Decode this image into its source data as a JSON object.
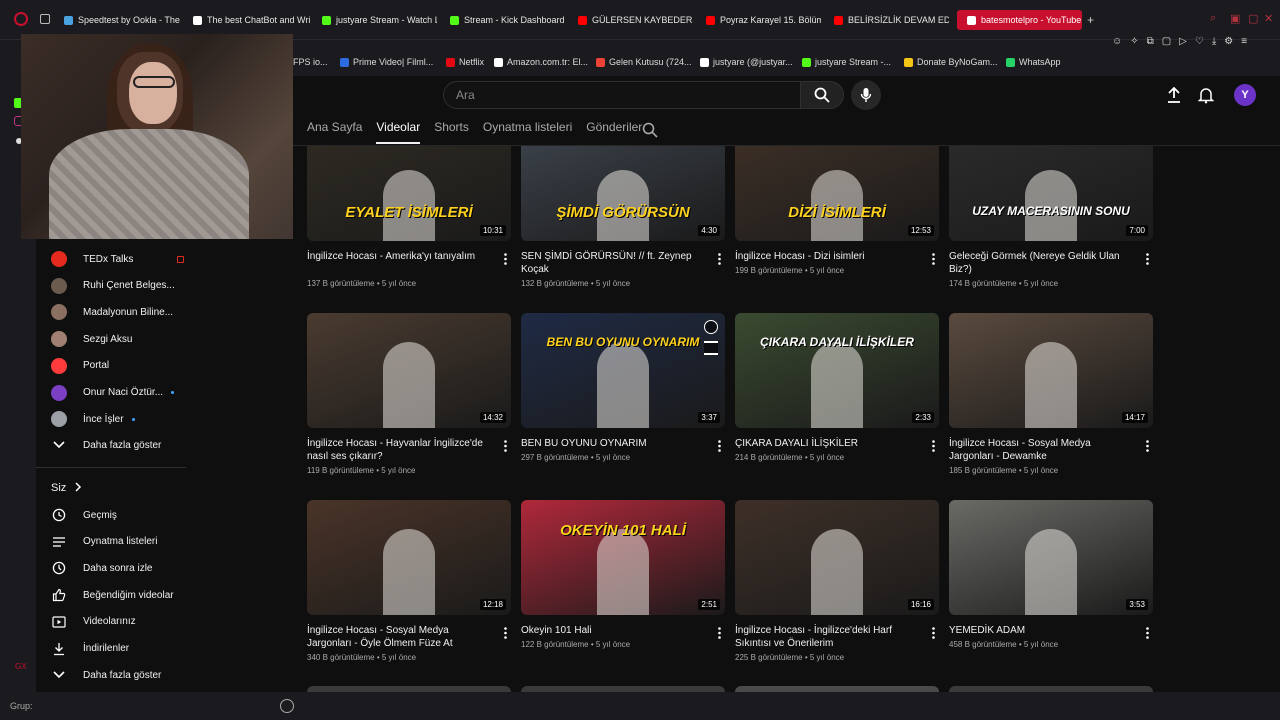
{
  "browser": {
    "tabs": [
      {
        "label": "Speedtest by Ookla - The",
        "color": "#4aa3df"
      },
      {
        "label": "The best ChatBot and Wri",
        "color": "#ffffff"
      },
      {
        "label": "justyare Stream - Watch L",
        "color": "#53fc18"
      },
      {
        "label": "Stream - Kick Dashboard",
        "color": "#53fc18"
      },
      {
        "label": "GÜLERSEN KAYBEDERSİN",
        "color": "#ff0000"
      },
      {
        "label": "Poyraz Karayel 15. Bölüm",
        "color": "#ff0000"
      },
      {
        "label": "BELİRSİZLİK DEVAM EDİY",
        "color": "#ff0000"
      },
      {
        "label": "batesmotelpro - YouTube",
        "color": "#ffffff",
        "active": true
      }
    ],
    "new_tab": "+",
    "bookmarks": [
      {
        "label": "FPS io...",
        "color": "#888888"
      },
      {
        "label": "Prime Video| Filml...",
        "color": "#2d6cdf"
      },
      {
        "label": "Netflix",
        "color": "#e50914"
      },
      {
        "label": "Amazon.com.tr: El...",
        "color": "#ffffff"
      },
      {
        "label": "Gelen Kutusu (724...",
        "color": "#ea4335"
      },
      {
        "label": "justyare (@justyar...",
        "color": "#ffffff"
      },
      {
        "label": "justyare Stream -...",
        "color": "#53fc18"
      },
      {
        "label": "Donate ByNoGam...",
        "color": "#f5c518"
      },
      {
        "label": "WhatsApp",
        "color": "#25d366"
      }
    ],
    "bottom_label": "Grup:"
  },
  "header": {
    "search_placeholder": "Ara",
    "avatar_letter": "Y"
  },
  "channel_tabs": [
    {
      "label": "Ana Sayfa",
      "active": false
    },
    {
      "label": "Videolar",
      "active": true
    },
    {
      "label": "Shorts",
      "active": false
    },
    {
      "label": "Oynatma listeleri",
      "active": false
    },
    {
      "label": "Gönderiler",
      "active": false
    }
  ],
  "sidebar": {
    "subscriptions": [
      {
        "label": "TEDx Talks",
        "color": "#e62b1e",
        "dot": false,
        "live": true
      },
      {
        "label": "Ruhi Çenet Belges...",
        "color": "#6b5b4e",
        "dot": false
      },
      {
        "label": "Madalyonun Biline...",
        "color": "#8a7060",
        "dot": false
      },
      {
        "label": "Sezgi Aksu",
        "color": "#a08070",
        "dot": false
      },
      {
        "label": "Portal",
        "color": "#ff3b3b",
        "dot": false
      },
      {
        "label": "Onur Naci Öztür...",
        "color": "#7b3fc4",
        "dot": true
      },
      {
        "label": "İnce İşler",
        "color": "#9aa0a6",
        "dot": true
      }
    ],
    "show_more_1": "Daha fazla göster",
    "you_section": "Siz",
    "you_items": [
      {
        "label": "Geçmiş",
        "icon": "history-icon"
      },
      {
        "label": "Oynatma listeleri",
        "icon": "playlist-icon"
      },
      {
        "label": "Daha sonra izle",
        "icon": "watch-later-icon"
      },
      {
        "label": "Beğendiğim videolar",
        "icon": "like-icon"
      },
      {
        "label": "Videolarınız",
        "icon": "your-videos-icon"
      },
      {
        "label": "İndirilenler",
        "icon": "download-icon"
      }
    ],
    "show_more_2": "Daha fazla göster"
  },
  "videos": [
    {
      "title": "İngilizce Hocası - Amerika'yı tanıyalım",
      "meta": "137 B görüntüleme • 5 yıl önce",
      "duration": "10:31",
      "thumb_text": "EYALET İSİMLERİ",
      "bg": "#2e2a22"
    },
    {
      "title": "SEN ŞİMDİ GÖRÜRSÜN! // ft. Zeynep Koçak",
      "meta": "132 B görüntüleme • 5 yıl önce",
      "duration": "4:30",
      "thumb_text": "ŞİMDİ GÖRÜRSÜN",
      "bg": "#3a4048"
    },
    {
      "title": "İngilizce Hocası - Dizi isimleri",
      "meta": "199 B görüntüleme • 5 yıl önce",
      "duration": "12:53",
      "thumb_text": "DİZİ İSİMLERİ",
      "bg": "#3b2e26"
    },
    {
      "title": "Geleceği Görmek (Nereye Geldik Ulan Biz?)",
      "meta": "174 B görüntüleme • 5 yıl önce",
      "duration": "7:00",
      "thumb_text": "UZAY MACERASININ SONU",
      "bg": "#2a2a2a"
    },
    {
      "title": "İngilizce Hocası - Hayvanlar İngilizce'de nasıl ses çıkarır?",
      "meta": "119 B görüntüleme • 5 yıl önce",
      "duration": "14:32",
      "thumb_text": "",
      "bg": "#4a3b30"
    },
    {
      "title": "BEN BU OYUNU OYNARIM",
      "meta": "297 B görüntüleme • 5 yıl önce",
      "duration": "3:37",
      "thumb_text": "BEN BU OYUNU OYNARIM",
      "bg": "#1f2a44"
    },
    {
      "title": "ÇIKARA DAYALI İLİŞKİLER",
      "meta": "214 B görüntüleme • 5 yıl önce",
      "duration": "2:33",
      "thumb_text": "ÇIKARA DAYALI İLİŞKİLER",
      "bg": "#3a4a30"
    },
    {
      "title": "İngilizce Hocası - Sosyal Medya Jargonları - Dewamke",
      "meta": "185 B görüntüleme • 5 yıl önce",
      "duration": "14:17",
      "thumb_text": "",
      "bg": "#5a4a3e"
    },
    {
      "title": "İngilizce Hocası - Sosyal Medya Jargonları - Öyle Ölmem Füze At",
      "meta": "340 B görüntüleme • 5 yıl önce",
      "duration": "12:18",
      "thumb_text": "",
      "bg": "#4a3428"
    },
    {
      "title": "Okeyin 101 Hali",
      "meta": "122 B görüntüleme • 5 yıl önce",
      "duration": "2:51",
      "thumb_text": "OKEYİN 101 HALİ",
      "bg": "#b0283a"
    },
    {
      "title": "İngilizce Hocası - İngilizce'deki Harf Sıkıntısı ve Önerilerim",
      "meta": "225 B görüntüleme • 5 yıl önce",
      "duration": "16:16",
      "thumb_text": "",
      "bg": "#3e3028"
    },
    {
      "title": "YEMEDİK ADAM",
      "meta": "458 B görüntüleme • 5 yıl önce",
      "duration": "3:53",
      "thumb_text": "",
      "bg": "#6a6a66"
    }
  ],
  "colors": {
    "accent": "#c8102e",
    "bg": "#0f0f0f",
    "avatar": "#6b33c8"
  }
}
